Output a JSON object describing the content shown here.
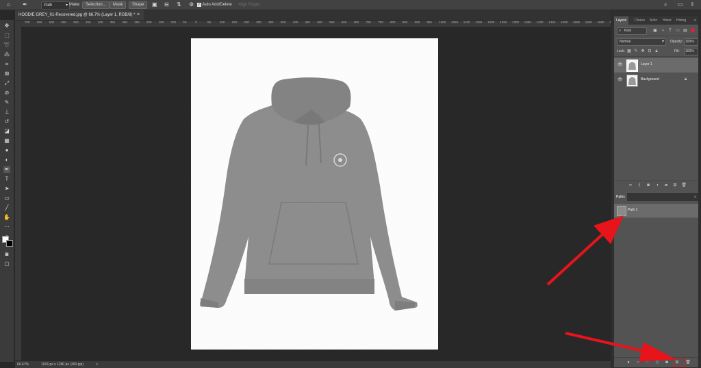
{
  "options_bar": {
    "mode_value": "Path",
    "make_label": "Make:",
    "selection_label": "Selection...",
    "mask_label": "Mask",
    "shape_label": "Shape",
    "auto_add_delete_label": "Auto Add/Delete",
    "align_edges_label": "Align Edges"
  },
  "document": {
    "tab_title": "HOODIE GREY_01-Recovered.jpg @ 66.7% (Layer 1, RGB/8) *",
    "close_glyph": "×"
  },
  "rulers": {
    "h_ticks": [
      "700",
      "650",
      "600",
      "550",
      "500",
      "450",
      "400",
      "350",
      "300",
      "250",
      "200",
      "150",
      "100",
      "50",
      "0",
      "50",
      "100",
      "150",
      "200",
      "250",
      "300",
      "350",
      "400",
      "450",
      "500",
      "550",
      "600",
      "650",
      "700",
      "750",
      "800",
      "850",
      "900",
      "950",
      "1000",
      "1050",
      "1100",
      "1150",
      "1200",
      "1250",
      "1300",
      "1350",
      "1400",
      "1450",
      "1500",
      "1550",
      "1600",
      "1650",
      "1700"
    ]
  },
  "status": {
    "zoom": "66.67%",
    "doc_info": "1016 px x 1280 px (300 ppi)",
    "arrow": ">"
  },
  "layers_panel": {
    "tabs": [
      "Layers",
      "Chann",
      "Actio",
      "Histor",
      "Histog"
    ],
    "kind_label": "Kind",
    "blend_mode": "Normal",
    "opacity_label": "Opacity:",
    "opacity_value": "100%",
    "lock_label": "Lock:",
    "fill_label": "Fill:",
    "fill_value": "100%",
    "layers": [
      {
        "name": "Layer 1",
        "selected": true
      },
      {
        "name": "Background",
        "selected": false
      }
    ]
  },
  "paths_panel": {
    "title": "Paths",
    "paths": [
      {
        "name": "Path 1"
      }
    ]
  },
  "colors": {
    "arrow_red": "#e8141b",
    "highlight_box": "#e8141b",
    "hoodie_grey": "#8f8f8f"
  }
}
